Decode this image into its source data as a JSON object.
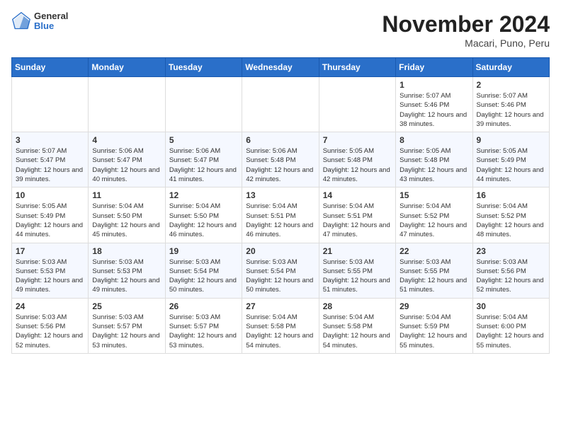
{
  "header": {
    "logo_general": "General",
    "logo_blue": "Blue",
    "title": "November 2024",
    "subtitle": "Macari, Puno, Peru"
  },
  "weekdays": [
    "Sunday",
    "Monday",
    "Tuesday",
    "Wednesday",
    "Thursday",
    "Friday",
    "Saturday"
  ],
  "weeks": [
    [
      null,
      null,
      null,
      null,
      null,
      {
        "day": "1",
        "sunrise": "5:07 AM",
        "sunset": "5:46 PM",
        "daylight": "12 hours and 38 minutes."
      },
      {
        "day": "2",
        "sunrise": "5:07 AM",
        "sunset": "5:46 PM",
        "daylight": "12 hours and 39 minutes."
      }
    ],
    [
      {
        "day": "3",
        "sunrise": "5:07 AM",
        "sunset": "5:47 PM",
        "daylight": "12 hours and 39 minutes."
      },
      {
        "day": "4",
        "sunrise": "5:06 AM",
        "sunset": "5:47 PM",
        "daylight": "12 hours and 40 minutes."
      },
      {
        "day": "5",
        "sunrise": "5:06 AM",
        "sunset": "5:47 PM",
        "daylight": "12 hours and 41 minutes."
      },
      {
        "day": "6",
        "sunrise": "5:06 AM",
        "sunset": "5:48 PM",
        "daylight": "12 hours and 42 minutes."
      },
      {
        "day": "7",
        "sunrise": "5:05 AM",
        "sunset": "5:48 PM",
        "daylight": "12 hours and 42 minutes."
      },
      {
        "day": "8",
        "sunrise": "5:05 AM",
        "sunset": "5:48 PM",
        "daylight": "12 hours and 43 minutes."
      },
      {
        "day": "9",
        "sunrise": "5:05 AM",
        "sunset": "5:49 PM",
        "daylight": "12 hours and 44 minutes."
      }
    ],
    [
      {
        "day": "10",
        "sunrise": "5:05 AM",
        "sunset": "5:49 PM",
        "daylight": "12 hours and 44 minutes."
      },
      {
        "day": "11",
        "sunrise": "5:04 AM",
        "sunset": "5:50 PM",
        "daylight": "12 hours and 45 minutes."
      },
      {
        "day": "12",
        "sunrise": "5:04 AM",
        "sunset": "5:50 PM",
        "daylight": "12 hours and 46 minutes."
      },
      {
        "day": "13",
        "sunrise": "5:04 AM",
        "sunset": "5:51 PM",
        "daylight": "12 hours and 46 minutes."
      },
      {
        "day": "14",
        "sunrise": "5:04 AM",
        "sunset": "5:51 PM",
        "daylight": "12 hours and 47 minutes."
      },
      {
        "day": "15",
        "sunrise": "5:04 AM",
        "sunset": "5:52 PM",
        "daylight": "12 hours and 47 minutes."
      },
      {
        "day": "16",
        "sunrise": "5:04 AM",
        "sunset": "5:52 PM",
        "daylight": "12 hours and 48 minutes."
      }
    ],
    [
      {
        "day": "17",
        "sunrise": "5:03 AM",
        "sunset": "5:53 PM",
        "daylight": "12 hours and 49 minutes."
      },
      {
        "day": "18",
        "sunrise": "5:03 AM",
        "sunset": "5:53 PM",
        "daylight": "12 hours and 49 minutes."
      },
      {
        "day": "19",
        "sunrise": "5:03 AM",
        "sunset": "5:54 PM",
        "daylight": "12 hours and 50 minutes."
      },
      {
        "day": "20",
        "sunrise": "5:03 AM",
        "sunset": "5:54 PM",
        "daylight": "12 hours and 50 minutes."
      },
      {
        "day": "21",
        "sunrise": "5:03 AM",
        "sunset": "5:55 PM",
        "daylight": "12 hours and 51 minutes."
      },
      {
        "day": "22",
        "sunrise": "5:03 AM",
        "sunset": "5:55 PM",
        "daylight": "12 hours and 51 minutes."
      },
      {
        "day": "23",
        "sunrise": "5:03 AM",
        "sunset": "5:56 PM",
        "daylight": "12 hours and 52 minutes."
      }
    ],
    [
      {
        "day": "24",
        "sunrise": "5:03 AM",
        "sunset": "5:56 PM",
        "daylight": "12 hours and 52 minutes."
      },
      {
        "day": "25",
        "sunrise": "5:03 AM",
        "sunset": "5:57 PM",
        "daylight": "12 hours and 53 minutes."
      },
      {
        "day": "26",
        "sunrise": "5:03 AM",
        "sunset": "5:57 PM",
        "daylight": "12 hours and 53 minutes."
      },
      {
        "day": "27",
        "sunrise": "5:04 AM",
        "sunset": "5:58 PM",
        "daylight": "12 hours and 54 minutes."
      },
      {
        "day": "28",
        "sunrise": "5:04 AM",
        "sunset": "5:58 PM",
        "daylight": "12 hours and 54 minutes."
      },
      {
        "day": "29",
        "sunrise": "5:04 AM",
        "sunset": "5:59 PM",
        "daylight": "12 hours and 55 minutes."
      },
      {
        "day": "30",
        "sunrise": "5:04 AM",
        "sunset": "6:00 PM",
        "daylight": "12 hours and 55 minutes."
      }
    ]
  ]
}
